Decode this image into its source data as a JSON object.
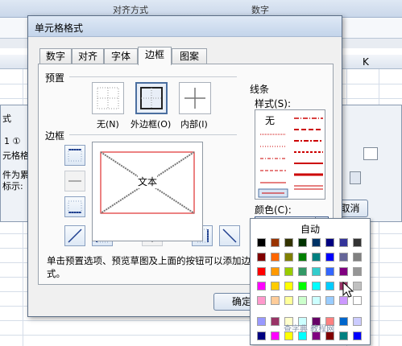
{
  "background": {
    "ribbon_groups": [
      "对齐方式",
      "数字"
    ],
    "column_k": "K",
    "left_fragments": [
      "式",
      "1 ①",
      "元格格",
      "件为累",
      "标示:"
    ],
    "cancel_label": "取消"
  },
  "dialog": {
    "title": "单元格格式",
    "tabs": [
      {
        "label": "数字"
      },
      {
        "label": "对齐"
      },
      {
        "label": "字体"
      },
      {
        "label": "边框",
        "active": true
      },
      {
        "label": "图案"
      }
    ],
    "presets": {
      "label": "预置",
      "items": [
        {
          "label": "无(N)"
        },
        {
          "label": "外边框(O)"
        },
        {
          "label": "内部(I)"
        }
      ]
    },
    "border": {
      "label": "边框",
      "preview_text": "文本"
    },
    "line": {
      "label": "线条",
      "style_label": "样式(S):",
      "none_label": "无"
    },
    "color": {
      "label": "颜色(C):",
      "selected": "#ff0000"
    },
    "hint": "单击预置选项、预览草图及上面的按钮可以添加边框样式。",
    "ok_label": "确定"
  },
  "color_popup": {
    "auto_label": "自动",
    "rows": [
      [
        "#000000",
        "#993300",
        "#333300",
        "#003300",
        "#003366",
        "#000080",
        "#333399",
        "#333333"
      ],
      [
        "#800000",
        "#ff6600",
        "#808000",
        "#008000",
        "#008080",
        "#0000ff",
        "#666699",
        "#808080"
      ],
      [
        "#ff0000",
        "#ff9900",
        "#99cc00",
        "#339966",
        "#33cccc",
        "#3366ff",
        "#800080",
        "#969696"
      ],
      [
        "#ff00ff",
        "#ffcc00",
        "#ffff00",
        "#00ff00",
        "#00ffff",
        "#00ccff",
        "#993366",
        "#c0c0c0"
      ],
      [
        "#ff99cc",
        "#ffcc99",
        "#ffff99",
        "#ccffcc",
        "#ccffff",
        "#99ccff",
        "#cc99ff",
        "#ffffff"
      ],
      [
        "#9999ff",
        "#993366",
        "#ffffcc",
        "#ccffff",
        "#660066",
        "#ff8080",
        "#0066cc",
        "#ccccff"
      ],
      [
        "#000080",
        "#ff00ff",
        "#ffff00",
        "#00ffff",
        "#800080",
        "#800000",
        "#008080",
        "#0000ff"
      ]
    ]
  },
  "watermark": "查字典 教程网"
}
